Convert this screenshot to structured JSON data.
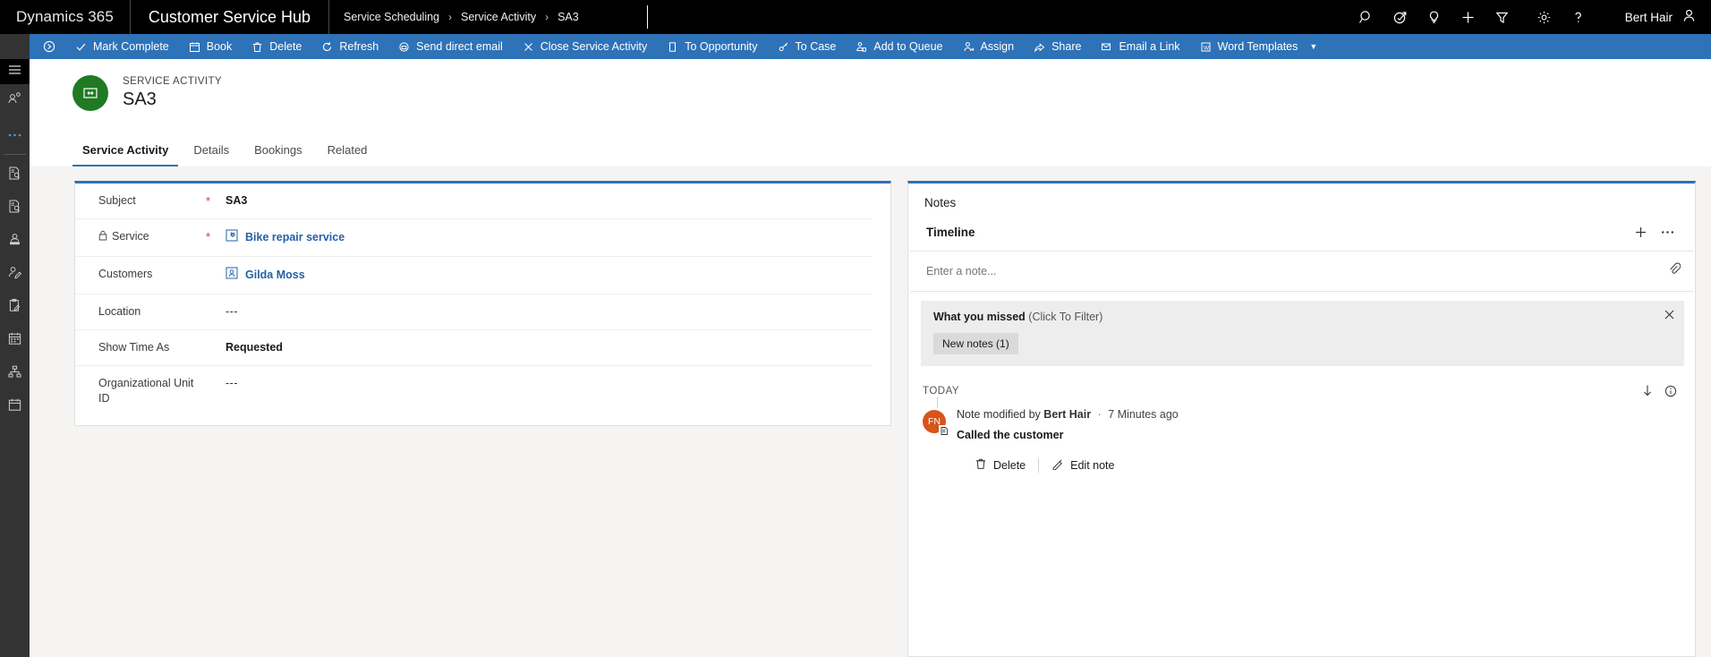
{
  "topbar": {
    "brand": "Dynamics 365",
    "app_name": "Customer Service Hub",
    "breadcrumbs": [
      "Service Scheduling",
      "Service Activity",
      "SA3"
    ],
    "separator": "›",
    "user_name": "Bert Hair",
    "icons": [
      "search-icon",
      "assistant-icon",
      "lightbulb-icon",
      "plus-icon",
      "filter-icon",
      "gear-icon",
      "help-icon"
    ]
  },
  "commandbar": {
    "overflow_label": "",
    "buttons": [
      {
        "label": "Mark Complete",
        "icon": "checkmark-icon"
      },
      {
        "label": "Book",
        "icon": "calendar-icon"
      },
      {
        "label": "Delete",
        "icon": "trash-icon"
      },
      {
        "label": "Refresh",
        "icon": "refresh-icon"
      },
      {
        "label": "Send direct email",
        "icon": "send-email-icon"
      },
      {
        "label": "Close Service Activity",
        "icon": "close-icon"
      },
      {
        "label": "To Opportunity",
        "icon": "opportunity-icon"
      },
      {
        "label": "To Case",
        "icon": "case-icon"
      },
      {
        "label": "Add to Queue",
        "icon": "queue-icon"
      },
      {
        "label": "Assign",
        "icon": "assign-icon"
      },
      {
        "label": "Share",
        "icon": "share-icon"
      },
      {
        "label": "Email a Link",
        "icon": "email-link-icon"
      },
      {
        "label": "Word Templates",
        "icon": "word-icon",
        "has_chevron": true
      }
    ]
  },
  "sidebar": {
    "items": [
      {
        "name": "hamburger-menu",
        "icon": "hamburger-icon"
      },
      {
        "name": "recent-records",
        "icon": "recent-user-icon"
      },
      {
        "name": "more-options",
        "icon": "ellipsis-icon"
      },
      {
        "name": "activities",
        "icon": "document-search-icon"
      },
      {
        "name": "cases",
        "icon": "document-search-icon"
      },
      {
        "name": "accounts",
        "icon": "person-card-icon"
      },
      {
        "name": "contacts",
        "icon": "person-edit-icon"
      },
      {
        "name": "service-activities",
        "icon": "clipboard-edit-icon"
      },
      {
        "name": "schedule-board",
        "icon": "calendar-grid-icon"
      },
      {
        "name": "service-hierarchy",
        "icon": "hierarchy-icon"
      },
      {
        "name": "service-calendar",
        "icon": "calendar-icon"
      }
    ]
  },
  "form_header": {
    "kicker": "SERVICE ACTIVITY",
    "title": "SA3",
    "icon": "service-activity-icon",
    "icon_color": "#1f7a23"
  },
  "tabs": [
    {
      "label": "Service Activity",
      "active": true
    },
    {
      "label": "Details",
      "active": false
    },
    {
      "label": "Bookings",
      "active": false
    },
    {
      "label": "Related",
      "active": false
    }
  ],
  "form": {
    "fields": [
      {
        "label": "Subject",
        "required": true,
        "locked": false,
        "value": "SA3",
        "value_type": "bold"
      },
      {
        "label": "Service",
        "required": true,
        "locked": true,
        "value": "Bike repair service",
        "value_type": "link",
        "icon": "service-icon"
      },
      {
        "label": "Customers",
        "required": false,
        "locked": false,
        "value": "Gilda Moss",
        "value_type": "link",
        "icon": "contact-icon"
      },
      {
        "label": "Location",
        "required": false,
        "locked": false,
        "value": "---",
        "value_type": "empty"
      },
      {
        "label": "Show Time As",
        "required": false,
        "locked": false,
        "value": "Requested",
        "value_type": "bold"
      },
      {
        "label": "Organizational Unit ID",
        "required": false,
        "locked": false,
        "value": "---",
        "value_type": "empty"
      }
    ]
  },
  "notes_panel": {
    "title": "Notes",
    "timeline_title": "Timeline",
    "add_icon": "plus-icon",
    "more_icon": "ellipsis-icon",
    "note_input_placeholder": "Enter a note...",
    "attach_icon": "paperclip-icon",
    "missed": {
      "title": "What you missed",
      "hint": "(Click To Filter)",
      "close_icon": "close-icon",
      "pill": "New notes (1)"
    },
    "today_label": "TODAY",
    "sort_icon": "sort-down-icon",
    "info_icon": "info-icon",
    "entries": [
      {
        "avatar_initials": "FN",
        "avatar_color": "#d8541a",
        "meta_prefix": "Note modified by",
        "author": "Bert Hair",
        "separator": "·",
        "time": "7 Minutes ago",
        "text": "Called the customer",
        "actions": [
          {
            "label": "Delete",
            "icon": "trash-icon"
          },
          {
            "label": "Edit note",
            "icon": "pencil-icon"
          }
        ]
      }
    ]
  }
}
